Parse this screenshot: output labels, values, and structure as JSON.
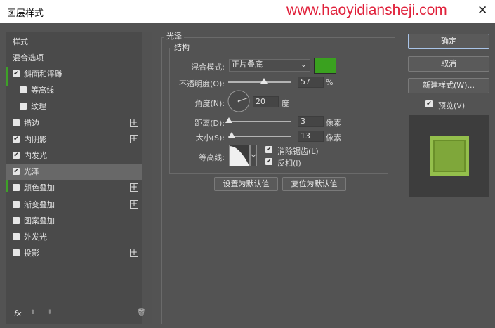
{
  "window": {
    "title": "图层样式",
    "watermark": "www.haoyidiansheji.com",
    "close_glyph": "✕"
  },
  "sidebar": {
    "styles_header": "样式",
    "blend_options": "混合选项",
    "items": [
      {
        "label": "斜面和浮雕",
        "checked": true
      },
      {
        "label": "等高线",
        "checked": false
      },
      {
        "label": "纹理",
        "checked": false
      },
      {
        "label": "描边",
        "checked": false
      },
      {
        "label": "内阴影",
        "checked": true
      },
      {
        "label": "内发光",
        "checked": true
      },
      {
        "label": "光泽",
        "checked": true
      },
      {
        "label": "颜色叠加",
        "checked": false
      },
      {
        "label": "渐变叠加",
        "checked": false
      },
      {
        "label": "图案叠加",
        "checked": false
      },
      {
        "label": "外发光",
        "checked": false
      },
      {
        "label": "投影",
        "checked": false
      }
    ],
    "plus_glyph": "+",
    "footer": {
      "fx": "fx",
      "up": "⬆",
      "down": "⬇",
      "trash": "🗑"
    }
  },
  "satin": {
    "section_title": "光泽",
    "group_title": "结构",
    "blend_mode_label": "混合模式:",
    "blend_mode_value": "正片叠底",
    "color": "#3aa11f",
    "opacity_label": "不透明度(O):",
    "opacity_value": "57",
    "opacity_unit": "%",
    "angle_label": "角度(N):",
    "angle_value": "20",
    "angle_unit": "度",
    "distance_label": "距离(D):",
    "distance_value": "3",
    "distance_unit": "像素",
    "size_label": "大小(S):",
    "size_value": "13",
    "size_unit": "像素",
    "contour_label": "等高线:",
    "antialias_label": "消除锯齿(L)",
    "invert_label": "反相(I)",
    "set_default": "设置为默认值",
    "reset_default": "复位为默认值"
  },
  "buttons": {
    "ok": "确定",
    "cancel": "取消",
    "new_style": "新建样式(W)...",
    "preview_label": "预览(V)"
  },
  "preview": {
    "swatch_color": "#7fa73a"
  }
}
